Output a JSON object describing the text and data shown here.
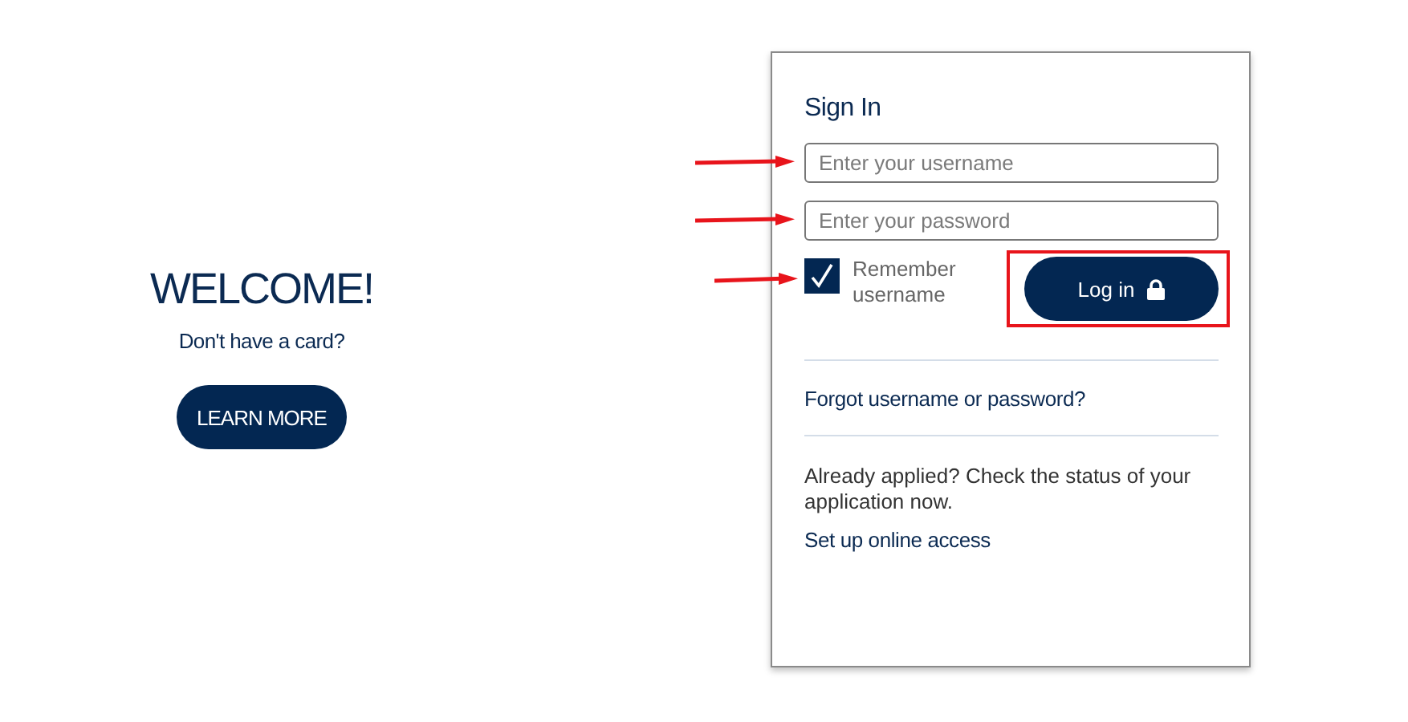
{
  "welcome": {
    "title": "WELCOME!",
    "subtitle": "Don't have a card?",
    "button": "LEARN MORE"
  },
  "sign_in": {
    "title": "Sign In",
    "fields": [
      {
        "placeholder": "Enter your username",
        "marked_with_arrow": true
      },
      {
        "placeholder": "Enter your password",
        "marked_with_arrow": true
      }
    ],
    "remember": {
      "label": "Remember username",
      "checked": true,
      "marked_with_arrow": true
    },
    "login_button": {
      "label": "Log in",
      "highlighted": true
    },
    "forgot_link": "Forgot username or password?",
    "status_text": "Already applied? Check the status of your application now.",
    "setup_link": "Set up online access"
  }
}
